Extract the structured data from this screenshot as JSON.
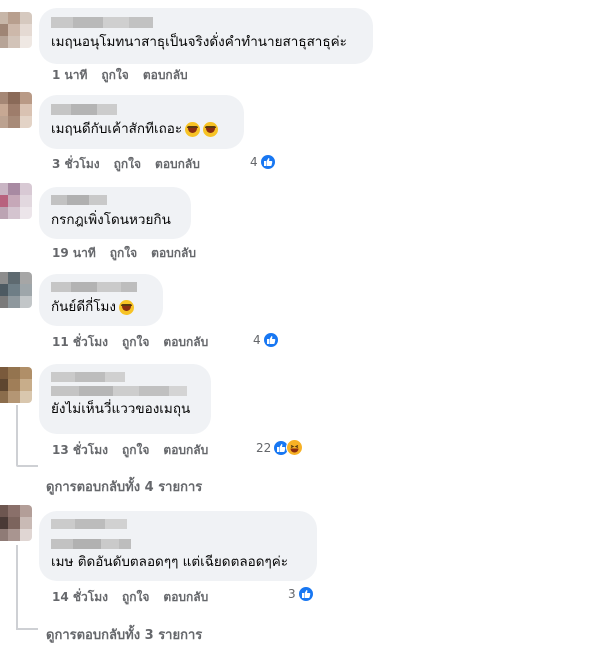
{
  "comments": [
    {
      "text": "เมฤนอนุโมทนาสาธุเป็นจริงดั่งคำทำนายสาธุสาธุค่ะ",
      "time": "1 นาที",
      "like": "ถูกใจ",
      "reply": "ตอบกลับ",
      "reaction_count": ""
    },
    {
      "text": "เมฤนดีกับเค้าสักทีเถอะ",
      "time": "3 ชั่วโมง",
      "like": "ถูกใจ",
      "reply": "ตอบกลับ",
      "reaction_count": "4"
    },
    {
      "text": "กรกฎเพิ่งโดนหวยกิน",
      "time": "19 นาที",
      "like": "ถูกใจ",
      "reply": "ตอบกลับ",
      "reaction_count": ""
    },
    {
      "text": "กันย์ดีกี่โมง",
      "time": "11 ชั่วโมง",
      "like": "ถูกใจ",
      "reply": "ตอบกลับ",
      "reaction_count": "4"
    },
    {
      "text": "ยังไม่เห็นวี่แววของเมถุน",
      "time": "13 ชั่วโมง",
      "like": "ถูกใจ",
      "reply": "ตอบกลับ",
      "reaction_count": "22"
    },
    {
      "text": "เมษ ติดอันดับตลอดๆๆ แต่เฉียดตลอดๆค่ะ",
      "time": "14 ชั่วโมง",
      "like": "ถูกใจ",
      "reply": "ตอบกลับ",
      "reaction_count": "3"
    }
  ],
  "view_replies": [
    {
      "label": "ดูการตอบกลับทั้ง 4 รายการ"
    },
    {
      "label": "ดูการตอบกลับทั้ง 3 รายการ"
    }
  ],
  "icons": {
    "like": "like-reaction-icon",
    "haha": "haha-reaction-icon",
    "laugh_emoji": "rolling-laughing-emoji"
  },
  "colors": {
    "bubble": "#f0f2f5",
    "meta_text": "#65676b",
    "like_blue": "#1877f2",
    "haha_yellow": "#f7b125"
  }
}
